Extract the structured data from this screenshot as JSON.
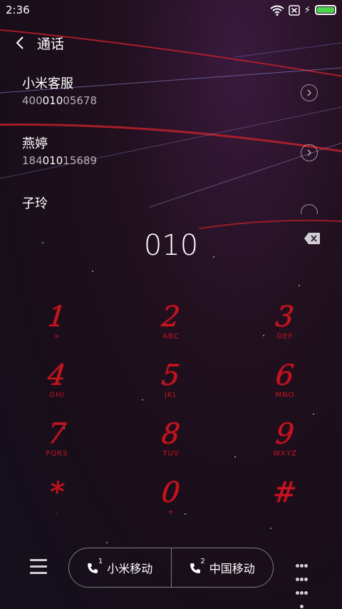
{
  "status_bar": {
    "time": "2:36"
  },
  "header": {
    "title": "通话"
  },
  "suggestions": [
    {
      "name": "小米客服",
      "number_pre": "400",
      "number_hl": "010",
      "number_post": "05678"
    },
    {
      "name": "燕婷",
      "number_pre": "184",
      "number_hl": "010",
      "number_post": "15689"
    },
    {
      "name": "子玲",
      "number_pre": "",
      "number_hl": "",
      "number_post": ""
    }
  ],
  "dial": {
    "number": "010"
  },
  "keypad": [
    {
      "digit": "1",
      "letters": "∞"
    },
    {
      "digit": "2",
      "letters": "ABC"
    },
    {
      "digit": "3",
      "letters": "DEF"
    },
    {
      "digit": "4",
      "letters": "GHI"
    },
    {
      "digit": "5",
      "letters": "JKL"
    },
    {
      "digit": "6",
      "letters": "MNO"
    },
    {
      "digit": "7",
      "letters": "PQRS"
    },
    {
      "digit": "8",
      "letters": "TUV"
    },
    {
      "digit": "9",
      "letters": "WXYZ"
    },
    {
      "digit": "*",
      "letters": ","
    },
    {
      "digit": "0",
      "letters": "+"
    },
    {
      "digit": "#",
      "letters": ""
    }
  ],
  "call_buttons": [
    {
      "sim": "1",
      "label": "小米移动"
    },
    {
      "sim": "2",
      "label": "中国移动"
    }
  ],
  "colors": {
    "key_red": "#c8141e",
    "battery_green": "#4bd64b"
  }
}
